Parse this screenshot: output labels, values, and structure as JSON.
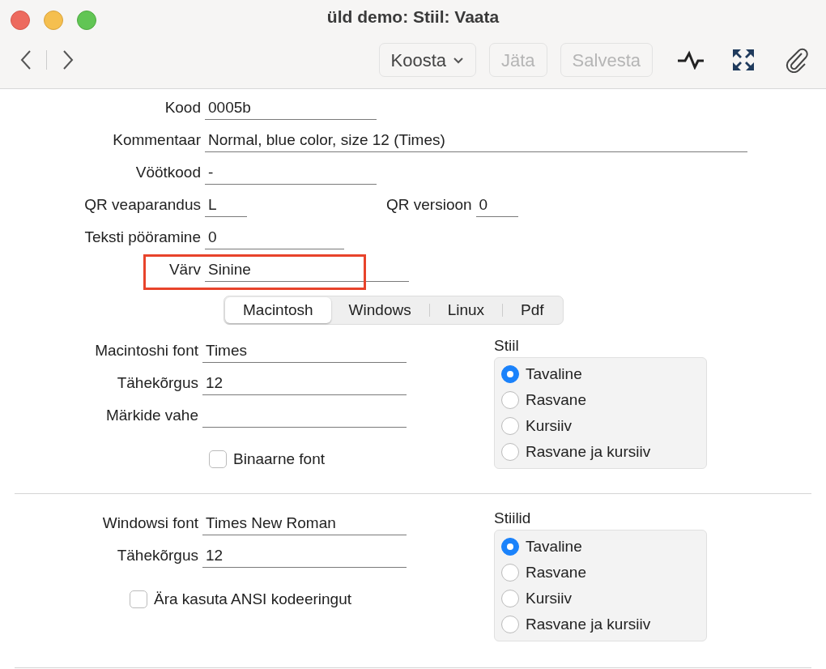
{
  "window": {
    "title": "üld demo: Stiil: Vaata"
  },
  "toolbar": {
    "buttons": [
      {
        "label": "Koosta",
        "kind": "menu",
        "disabled": false
      },
      {
        "label": "Jäta",
        "kind": "plain",
        "disabled": true
      },
      {
        "label": "Salvesta",
        "kind": "plain",
        "disabled": true
      }
    ]
  },
  "form": {
    "rows": [
      [
        {
          "label": "Kood",
          "value": "0005b",
          "highlighted": false
        }
      ],
      [
        {
          "label": "Kommentaar",
          "value": "Normal, blue color, size 12 (Times)",
          "highlighted": false
        }
      ],
      [
        {
          "label": "Vöötkood",
          "value": "-",
          "highlighted": false
        }
      ],
      [
        {
          "label": "QR veaparandus",
          "value": "L",
          "highlighted": false
        },
        {
          "label": "QR versioon",
          "value": "0",
          "highlighted": false
        }
      ],
      [
        {
          "label": "Teksti pööramine",
          "value": "0",
          "highlighted": false
        }
      ],
      [
        {
          "label": "Värv",
          "value": "Sinine",
          "highlighted": true
        }
      ]
    ]
  },
  "tabs": [
    {
      "label": "Macintosh",
      "selected": true
    },
    {
      "label": "Windows",
      "selected": false
    },
    {
      "label": "Linux",
      "selected": false
    },
    {
      "label": "Pdf",
      "selected": false
    }
  ],
  "sections": [
    {
      "fields": [
        {
          "label": "Macintoshi font",
          "value": "Times"
        },
        {
          "label": "Tähekõrgus",
          "value": "12"
        },
        {
          "label": "Märkide vahe"
        }
      ],
      "checkbox": {
        "label": "Binaarne font",
        "checked": false
      },
      "style_group": {
        "title": "Stiil",
        "options": [
          {
            "label": "Tavaline",
            "selected": true
          },
          {
            "label": "Rasvane",
            "selected": false
          },
          {
            "label": "Kursiiv",
            "selected": false
          },
          {
            "label": "Rasvane ja kursiiv",
            "selected": false
          }
        ]
      }
    },
    {
      "fields": [
        {
          "label": "Windowsi font",
          "value": "Times New Roman"
        },
        {
          "label": "Tähekõrgus",
          "value": "12"
        }
      ],
      "checkbox": {
        "label": "Ära kasuta ANSI kodeeringut",
        "checked": false
      },
      "style_group": {
        "title": "Stiilid",
        "options": [
          {
            "label": "Tavaline",
            "selected": true
          },
          {
            "label": "Rasvane",
            "selected": false
          },
          {
            "label": "Kursiiv",
            "selected": false
          },
          {
            "label": "Rasvane ja kursiiv",
            "selected": false
          }
        ]
      }
    }
  ]
}
